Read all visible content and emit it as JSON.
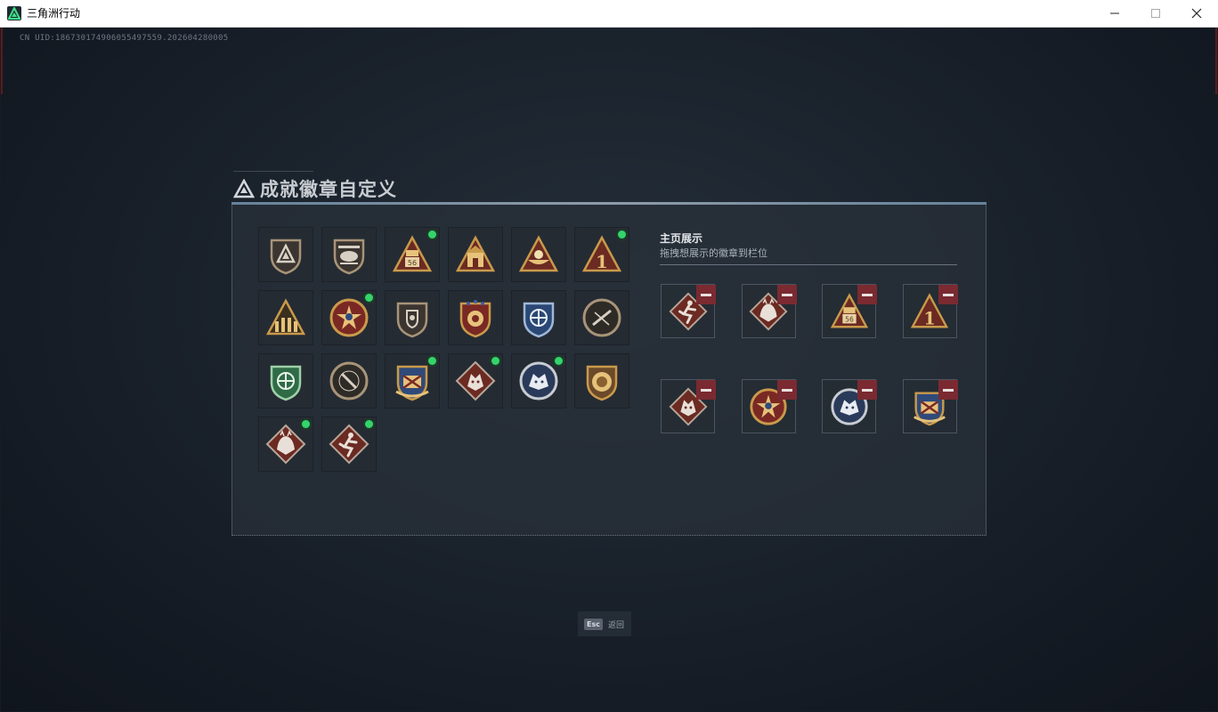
{
  "window": {
    "title": "三角洲行动",
    "icon": "delta-logo-icon"
  },
  "game": {
    "uid_text": "CN UID:18673017490605549755​9.202604280005"
  },
  "heading": {
    "title": "成就徽章自定义",
    "icon": "delta-triangle-icon"
  },
  "badges": [
    {
      "name": "triangle-shield-badge",
      "new": false
    },
    {
      "name": "helicopter-badge",
      "new": false
    },
    {
      "name": "triangle-56-badge",
      "new": true
    },
    {
      "name": "triangle-building-badge",
      "new": false
    },
    {
      "name": "triangle-boat-badge",
      "new": false
    },
    {
      "name": "triangle-1-badge",
      "new": true
    },
    {
      "name": "triangle-soldiers-badge",
      "new": false
    },
    {
      "name": "star-medal-badge",
      "new": true
    },
    {
      "name": "crest-shield-badge",
      "new": false
    },
    {
      "name": "ornate-shield-badge",
      "new": false
    },
    {
      "name": "blue-crosshair-badge",
      "new": false
    },
    {
      "name": "rifle-circle-badge",
      "new": false
    },
    {
      "name": "green-crosshair-badge",
      "new": false
    },
    {
      "name": "knife-circle-badge",
      "new": false
    },
    {
      "name": "winged-crest-badge",
      "new": true
    },
    {
      "name": "wolf-diamond-badge",
      "new": true
    },
    {
      "name": "wolf-circle-badge",
      "new": true
    },
    {
      "name": "lion-shield-badge",
      "new": false
    },
    {
      "name": "dragon-diamond-badge",
      "new": true
    },
    {
      "name": "runner-diamond-badge",
      "new": true
    }
  ],
  "display": {
    "title": "主页展示",
    "subtitle": "拖拽想展示的徽章到栏位",
    "slots": [
      {
        "name": "runner-diamond-badge"
      },
      {
        "name": "dragon-diamond-badge"
      },
      {
        "name": "triangle-56-badge"
      },
      {
        "name": "triangle-1-badge"
      },
      {
        "name": "wolf-diamond-badge"
      },
      {
        "name": "star-medal-badge"
      },
      {
        "name": "wolf-circle-badge"
      },
      {
        "name": "winged-crest-badge"
      }
    ]
  },
  "footer": {
    "esc_key": "Esc",
    "back_label": "返回"
  },
  "colors": {
    "accent_green": "#35d36b",
    "remove_red": "#7a2a30",
    "gold": "#c99a4b"
  }
}
